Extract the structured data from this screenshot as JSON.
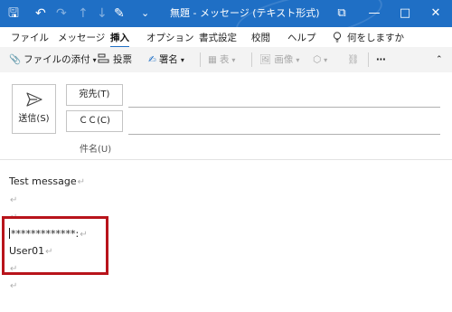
{
  "window": {
    "title": "無題 - メッセージ (テキスト形式)",
    "controls": {
      "restore_label": "⧉",
      "minimize_label": "—",
      "maximize_label": "□",
      "close_label": "✕"
    }
  },
  "qat": {
    "save_glyph": "🖫",
    "undo_glyph": "↶",
    "redo_glyph": "↷",
    "up_glyph": "↑",
    "down_glyph": "↓",
    "format_glyph": "✎",
    "more_glyph": "⌄"
  },
  "menu": {
    "items": [
      "ファイル",
      "メッセージ",
      "挿入",
      "オプション",
      "書式設定",
      "校閲",
      "ヘルプ"
    ],
    "active_index": 2,
    "help_search": "何をしますか"
  },
  "ribbon": {
    "attach_file": "ファイルの添付",
    "poll": "投票",
    "signature": "署名",
    "table": "表",
    "image": "画像",
    "more": "⋯"
  },
  "compose": {
    "send_label": "送信(S)",
    "to_label": "宛先(T)",
    "cc_label": "ＣＣ(C)",
    "subject_label": "件名(U)"
  },
  "body": {
    "lines": [
      "Test message",
      "",
      "",
      "*************:",
      "User01",
      "",
      ""
    ]
  },
  "colors": {
    "titlebar": "#1f6fc5",
    "highlight_box": "#b8141b"
  }
}
